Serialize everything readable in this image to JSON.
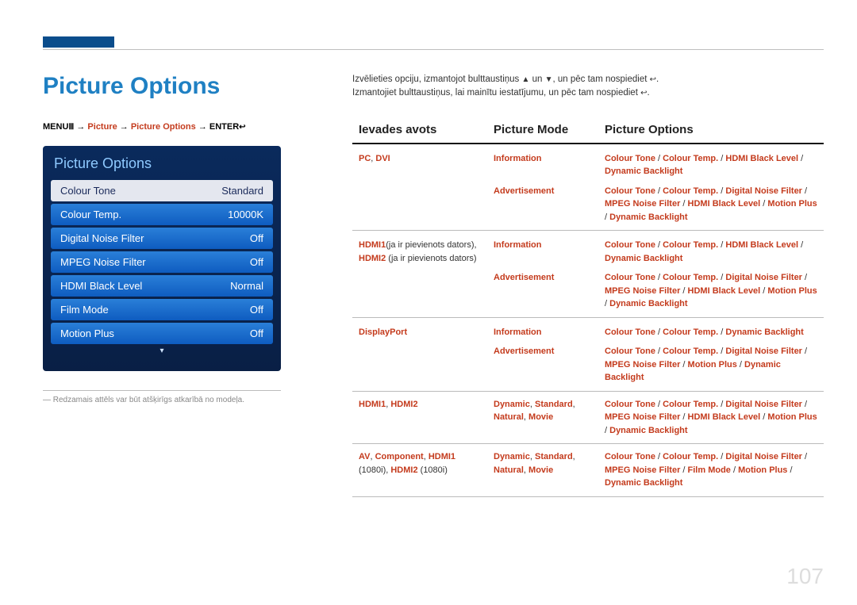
{
  "pageTitle": "Picture Options",
  "navpath": {
    "menu": "MENU",
    "menuIcon": "Ⅲ",
    "arrow": " → ",
    "p1": "Picture",
    "p2": "Picture Options",
    "enter": "ENTER",
    "enterIcon": "↩"
  },
  "osd": {
    "title": "Picture Options",
    "rows": [
      {
        "label": "Colour Tone",
        "value": "Standard",
        "selected": true
      },
      {
        "label": "Colour Temp.",
        "value": "10000K",
        "selected": false
      },
      {
        "label": "Digital Noise Filter",
        "value": "Off",
        "selected": false
      },
      {
        "label": "MPEG Noise Filter",
        "value": "Off",
        "selected": false
      },
      {
        "label": "HDMI Black Level",
        "value": "Normal",
        "selected": false
      },
      {
        "label": "Film Mode",
        "value": "Off",
        "selected": false
      },
      {
        "label": "Motion Plus",
        "value": "Off",
        "selected": false
      }
    ],
    "arrow": "▾"
  },
  "footnote": "― Redzamais attēls var būt atšķirīgs atkarībā no modeļa.",
  "intro": {
    "l1a": "Izvēlieties opciju, izmantojot bulttaustiņus ",
    "l1b": " un ",
    "l1c": ", un pēc tam nospiediet ",
    "l1d": ".",
    "l2a": "Izmantojiet bulttaustiņus, lai mainītu iestatījumu, un pēc tam nospiediet ",
    "l2b": ".",
    "up": "▲",
    "down": "▼",
    "enter": "↩"
  },
  "tableHeaders": {
    "c1": "Ievades avots",
    "c2": "Picture Mode",
    "c3": "Picture Options"
  },
  "rows": [
    {
      "src": [
        {
          "t": "PC",
          "r": true
        },
        {
          "t": ", ",
          "r": false
        },
        {
          "t": "DVI",
          "r": true
        }
      ],
      "sub": [
        {
          "mode": [
            {
              "t": "Information",
              "r": true
            }
          ],
          "opts": [
            {
              "t": "Colour Tone",
              "r": true
            },
            {
              "t": " / ",
              "r": false
            },
            {
              "t": "Colour Temp.",
              "r": true
            },
            {
              "t": " / ",
              "r": false
            },
            {
              "t": "HDMI Black Level",
              "r": true
            },
            {
              "t": " / ",
              "r": false
            },
            {
              "t": "Dynamic Backlight",
              "r": true
            }
          ]
        },
        {
          "mode": [
            {
              "t": "Advertisement",
              "r": true
            }
          ],
          "opts": [
            {
              "t": "Colour Tone",
              "r": true
            },
            {
              "t": " / ",
              "r": false
            },
            {
              "t": "Colour Temp.",
              "r": true
            },
            {
              "t": " / ",
              "r": false
            },
            {
              "t": "Digital Noise Filter",
              "r": true
            },
            {
              "t": " / ",
              "r": false
            },
            {
              "t": "MPEG Noise Filter",
              "r": true
            },
            {
              "t": " / ",
              "r": false
            },
            {
              "t": "HDMI Black Level",
              "r": true
            },
            {
              "t": " / ",
              "r": false
            },
            {
              "t": "Motion Plus",
              "r": true
            },
            {
              "t": " / ",
              "r": false
            },
            {
              "t": "Dynamic Backlight",
              "r": true
            }
          ]
        }
      ]
    },
    {
      "src": [
        {
          "t": "HDMI1",
          "r": true
        },
        {
          "t": "(ja ir pievienots dators), ",
          "r": false
        },
        {
          "t": "HDMI2",
          "r": true
        },
        {
          "t": " (ja ir pievienots dators)",
          "r": false
        }
      ],
      "sub": [
        {
          "mode": [
            {
              "t": "Information",
              "r": true
            }
          ],
          "opts": [
            {
              "t": "Colour Tone",
              "r": true
            },
            {
              "t": " / ",
              "r": false
            },
            {
              "t": "Colour Temp.",
              "r": true
            },
            {
              "t": " / ",
              "r": false
            },
            {
              "t": "HDMI Black Level",
              "r": true
            },
            {
              "t": " / ",
              "r": false
            },
            {
              "t": "Dynamic Backlight",
              "r": true
            }
          ]
        },
        {
          "mode": [
            {
              "t": "Advertisement",
              "r": true
            }
          ],
          "opts": [
            {
              "t": "Colour Tone",
              "r": true
            },
            {
              "t": " / ",
              "r": false
            },
            {
              "t": "Colour Temp.",
              "r": true
            },
            {
              "t": " / ",
              "r": false
            },
            {
              "t": "Digital Noise Filter",
              "r": true
            },
            {
              "t": " / ",
              "r": false
            },
            {
              "t": "MPEG Noise Filter",
              "r": true
            },
            {
              "t": " / ",
              "r": false
            },
            {
              "t": "HDMI Black Level",
              "r": true
            },
            {
              "t": " / ",
              "r": false
            },
            {
              "t": "Motion Plus",
              "r": true
            },
            {
              "t": " / ",
              "r": false
            },
            {
              "t": "Dynamic Backlight",
              "r": true
            }
          ]
        }
      ]
    },
    {
      "src": [
        {
          "t": "DisplayPort",
          "r": true
        }
      ],
      "sub": [
        {
          "mode": [
            {
              "t": "Information",
              "r": true
            }
          ],
          "opts": [
            {
              "t": "Colour Tone",
              "r": true
            },
            {
              "t": " / ",
              "r": false
            },
            {
              "t": "Colour Temp.",
              "r": true
            },
            {
              "t": " / ",
              "r": false
            },
            {
              "t": "Dynamic Backlight",
              "r": true
            }
          ]
        },
        {
          "mode": [
            {
              "t": "Advertisement",
              "r": true
            }
          ],
          "opts": [
            {
              "t": "Colour Tone",
              "r": true
            },
            {
              "t": " / ",
              "r": false
            },
            {
              "t": "Colour Temp.",
              "r": true
            },
            {
              "t": " / ",
              "r": false
            },
            {
              "t": "Digital Noise Filter",
              "r": true
            },
            {
              "t": " / ",
              "r": false
            },
            {
              "t": "MPEG Noise Filter",
              "r": true
            },
            {
              "t": " / ",
              "r": false
            },
            {
              "t": "Motion Plus",
              "r": true
            },
            {
              "t": " / ",
              "r": false
            },
            {
              "t": "Dynamic Backlight",
              "r": true
            }
          ]
        }
      ]
    },
    {
      "src": [
        {
          "t": "HDMI1",
          "r": true
        },
        {
          "t": ", ",
          "r": false
        },
        {
          "t": "HDMI2",
          "r": true
        }
      ],
      "sub": [
        {
          "mode": [
            {
              "t": "Dynamic",
              "r": true
            },
            {
              "t": ", ",
              "r": false
            },
            {
              "t": "Standard",
              "r": true
            },
            {
              "t": ", ",
              "r": false
            },
            {
              "t": "Natural",
              "r": true
            },
            {
              "t": ", ",
              "r": false
            },
            {
              "t": "Movie",
              "r": true
            }
          ],
          "opts": [
            {
              "t": "Colour Tone",
              "r": true
            },
            {
              "t": " / ",
              "r": false
            },
            {
              "t": "Colour Temp.",
              "r": true
            },
            {
              "t": " / ",
              "r": false
            },
            {
              "t": "Digital Noise Filter",
              "r": true
            },
            {
              "t": " / ",
              "r": false
            },
            {
              "t": "MPEG Noise Filter",
              "r": true
            },
            {
              "t": " / ",
              "r": false
            },
            {
              "t": "HDMI Black Level",
              "r": true
            },
            {
              "t": " / ",
              "r": false
            },
            {
              "t": "Motion Plus",
              "r": true
            },
            {
              "t": " / ",
              "r": false
            },
            {
              "t": "Dynamic Backlight",
              "r": true
            }
          ]
        }
      ]
    },
    {
      "src": [
        {
          "t": "AV",
          "r": true
        },
        {
          "t": ", ",
          "r": false
        },
        {
          "t": "Component",
          "r": true
        },
        {
          "t": ", ",
          "r": false
        },
        {
          "t": "HDMI1",
          "r": true
        },
        {
          "t": " (1080i), ",
          "r": false
        },
        {
          "t": "HDMI2",
          "r": true
        },
        {
          "t": " (1080i)",
          "r": false
        }
      ],
      "sub": [
        {
          "mode": [
            {
              "t": "Dynamic",
              "r": true
            },
            {
              "t": ", ",
              "r": false
            },
            {
              "t": "Standard",
              "r": true
            },
            {
              "t": ", ",
              "r": false
            },
            {
              "t": "Natural",
              "r": true
            },
            {
              "t": ", ",
              "r": false
            },
            {
              "t": "Movie",
              "r": true
            }
          ],
          "opts": [
            {
              "t": "Colour Tone",
              "r": true
            },
            {
              "t": " / ",
              "r": false
            },
            {
              "t": "Colour Temp.",
              "r": true
            },
            {
              "t": " / ",
              "r": false
            },
            {
              "t": "Digital Noise Filter",
              "r": true
            },
            {
              "t": " / ",
              "r": false
            },
            {
              "t": "MPEG Noise Filter",
              "r": true
            },
            {
              "t": " / ",
              "r": false
            },
            {
              "t": "Film Mode",
              "r": true
            },
            {
              "t": " / ",
              "r": false
            },
            {
              "t": "Motion Plus",
              "r": true
            },
            {
              "t": " / ",
              "r": false
            },
            {
              "t": "Dynamic Backlight",
              "r": true
            }
          ]
        }
      ]
    }
  ],
  "pageNumber": "107"
}
